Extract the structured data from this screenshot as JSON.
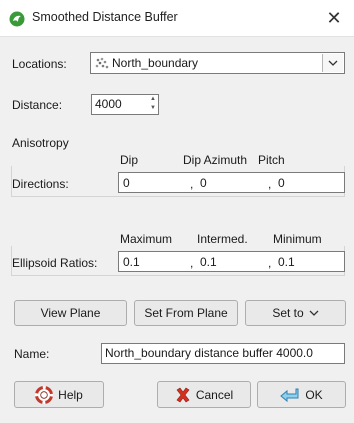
{
  "window": {
    "title": "Smoothed Distance Buffer",
    "close_glyph": "✕",
    "app_icon": "leapfrog-app-icon"
  },
  "locations": {
    "label": "Locations:",
    "value": "North_boundary",
    "icon": "points-icon"
  },
  "distance": {
    "label": "Distance:",
    "value": "4000"
  },
  "anisotropy": {
    "heading": "Anisotropy",
    "directions_label": "Directions:",
    "dir_headers": [
      "Dip",
      "Dip Azimuth",
      "Pitch"
    ],
    "directions": [
      "0",
      "0",
      "0"
    ],
    "ellipsoid_label": "Ellipsoid Ratios:",
    "ratio_headers": [
      "Maximum",
      "Intermed.",
      "Minimum"
    ],
    "ratios": [
      "0.1",
      "0.1",
      "0.1"
    ],
    "separator": ","
  },
  "buttons": {
    "view_plane": "View Plane",
    "set_from_plane": "Set From Plane",
    "set_to": "Set to",
    "help": "Help",
    "cancel": "Cancel",
    "ok": "OK"
  },
  "name": {
    "label": "Name:",
    "value": "North_boundary distance buffer 4000.0"
  }
}
